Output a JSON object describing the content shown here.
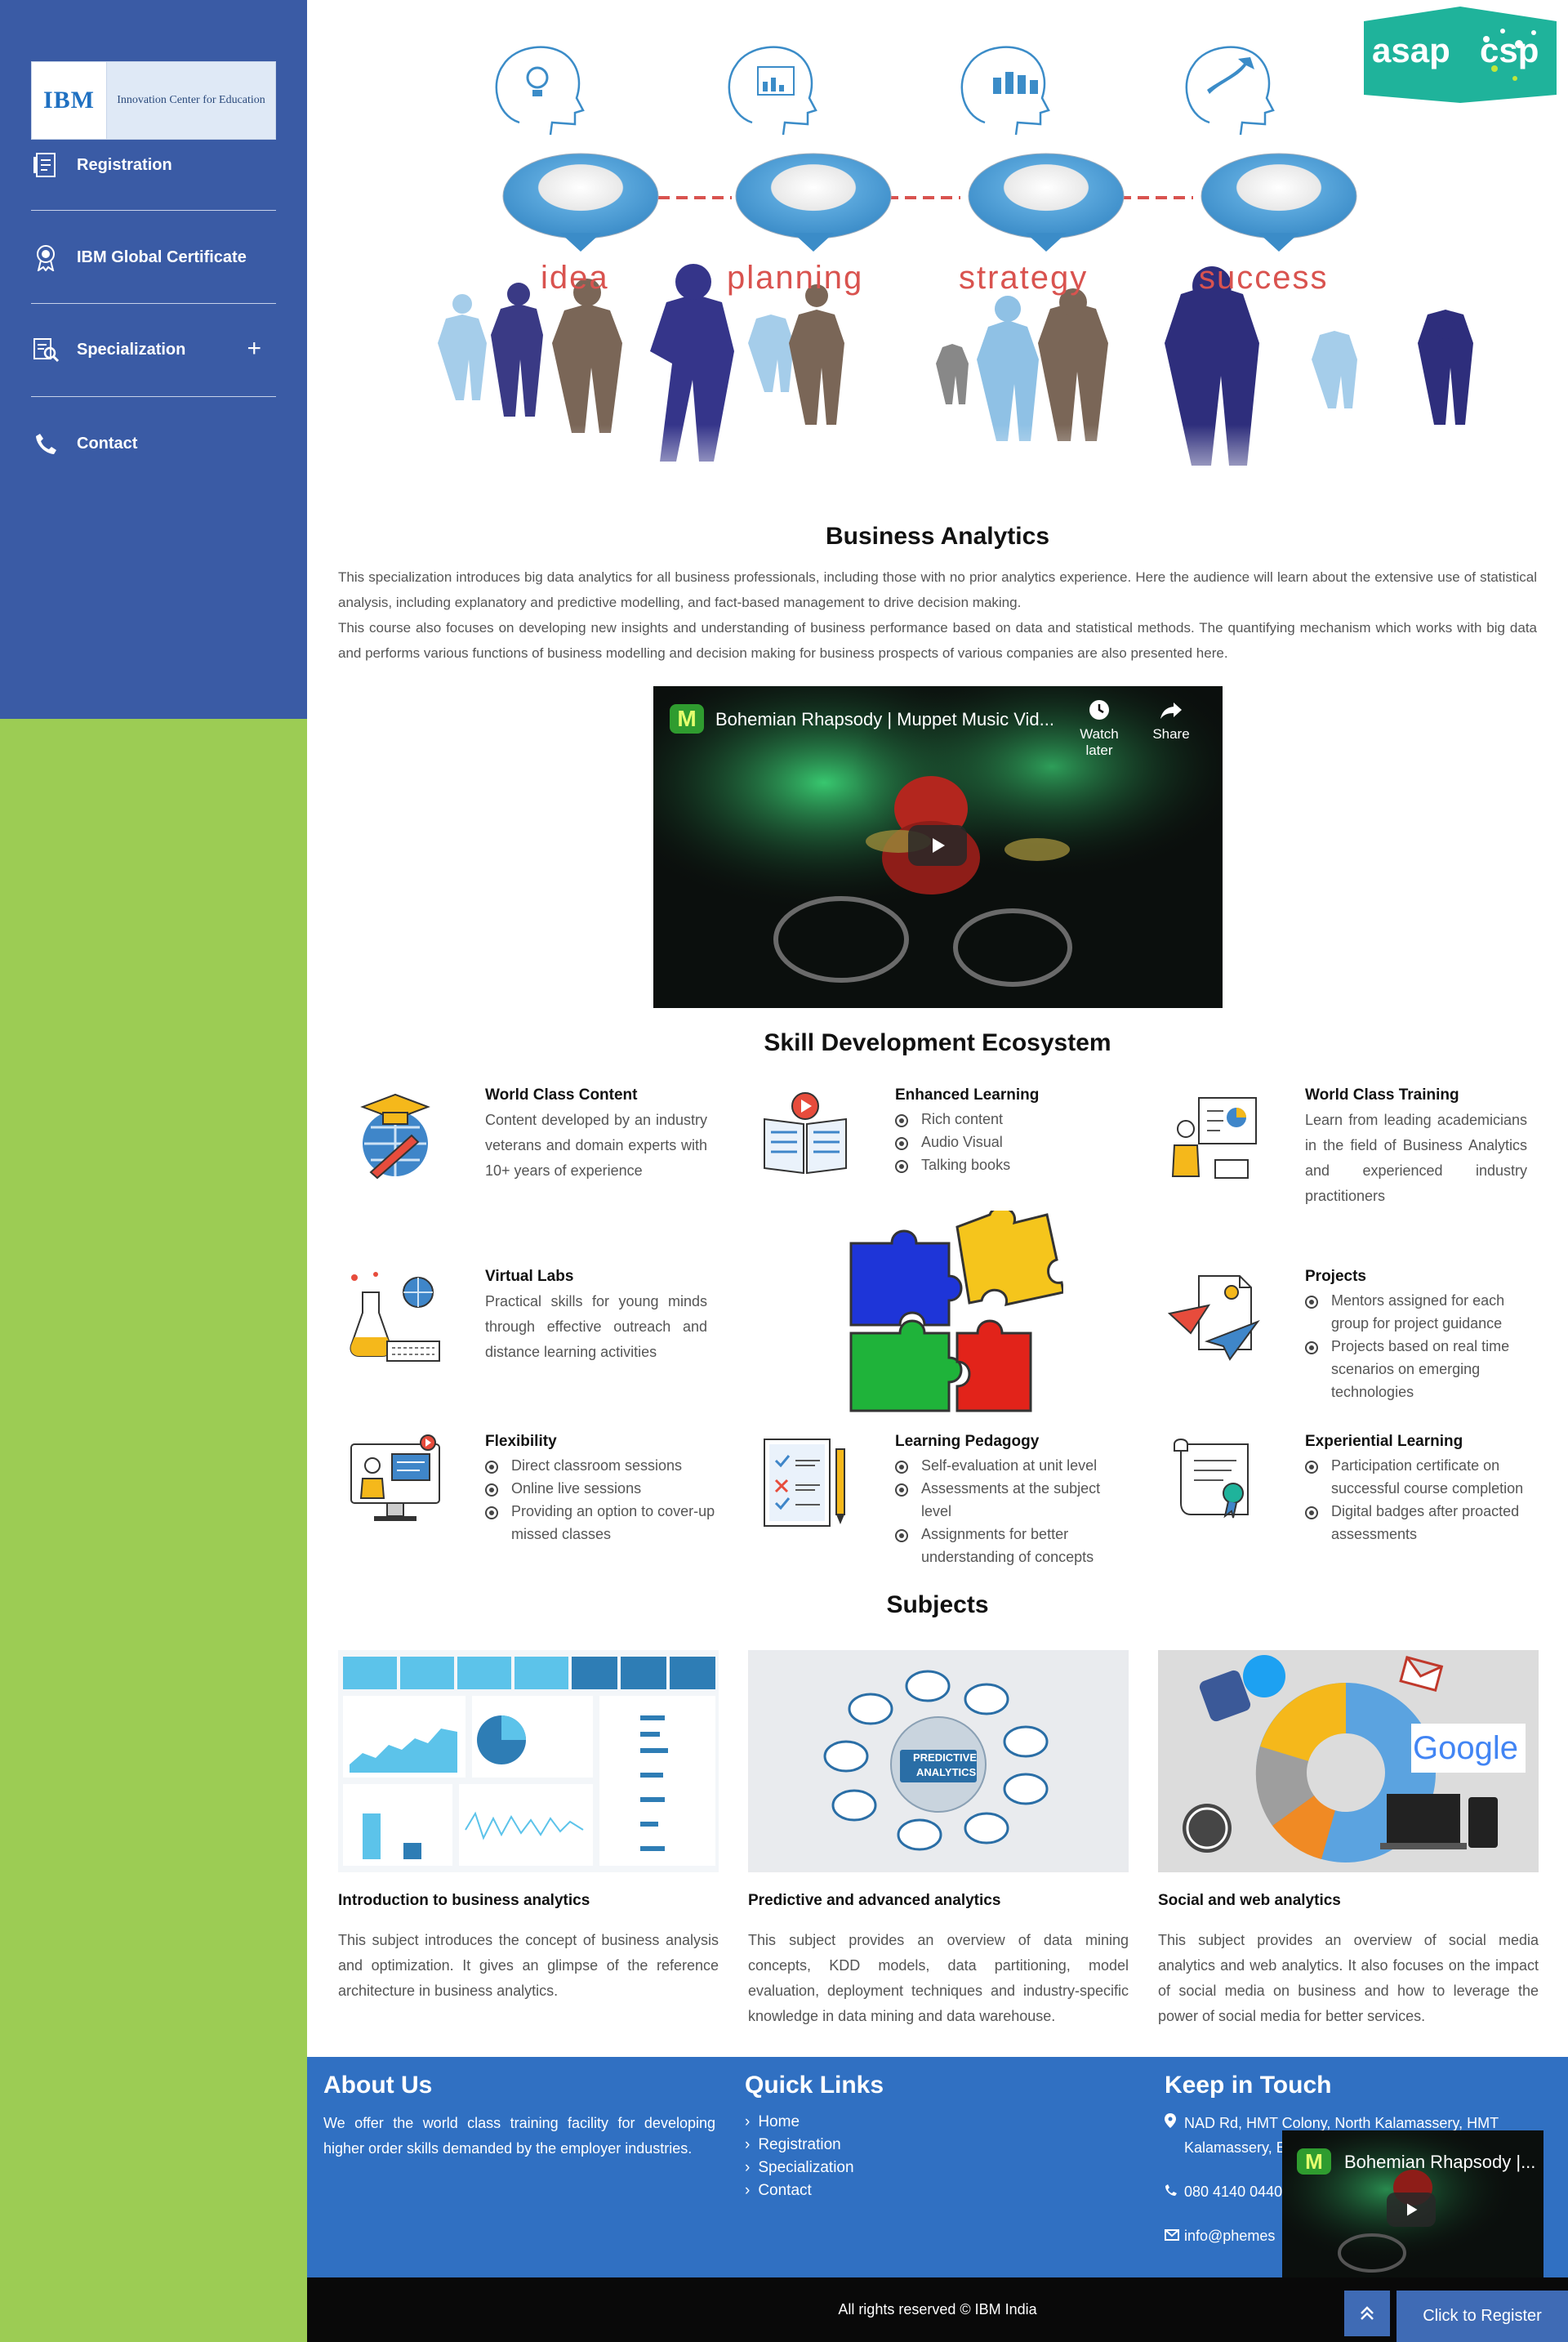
{
  "sidebar": {
    "logo": {
      "brand": "IBM",
      "subtitle": "Innovation Center for Education"
    },
    "items": [
      {
        "label": "Registration",
        "icon": "document-icon"
      },
      {
        "label": "IBM Global Certificate",
        "icon": "award-icon"
      },
      {
        "label": "Specialization",
        "icon": "search-document-icon",
        "expand": "+"
      },
      {
        "label": "Contact",
        "icon": "phone-icon"
      }
    ]
  },
  "hero": {
    "badge": {
      "left": "asap",
      "right": "csp"
    },
    "steps": [
      "idea",
      "planning",
      "strategy",
      "success"
    ]
  },
  "intro": {
    "title": "Business Analytics",
    "p1": "This specialization introduces big data analytics for all business professionals, including those with no prior analytics experience. Here the audience will learn about the extensive use of statistical analysis, including explanatory and predictive modelling, and fact-based management to drive decision making.",
    "p2": "This course also focuses on developing new insights and understanding of business performance based on data and statistical methods. The quantifying mechanism which works with big data and performs various functions of business modelling and decision making for business prospects of various companies are also presented here."
  },
  "video": {
    "title": "Bohemian Rhapsody | Muppet Music Vid...",
    "watch_later": "Watch later",
    "share": "Share",
    "logo_letter": "M"
  },
  "skills": {
    "title": "Skill Development Ecosystem",
    "world_class_content": {
      "title": "World Class Content",
      "body": "Content developed by an industry veterans and domain experts with 10+ years of experience"
    },
    "enhanced_learning": {
      "title": "Enhanced Learning",
      "items": [
        "Rich content",
        "Audio Visual",
        "Talking books"
      ]
    },
    "world_class_training": {
      "title": "World Class Training",
      "body": "Learn from leading academicians in the field of Business Analytics and experienced industry practitioners"
    },
    "virtual_labs": {
      "title": "Virtual Labs",
      "body": "Practical skills for young minds through effective outreach and distance learning activities"
    },
    "projects": {
      "title": "Projects",
      "items": [
        "Mentors assigned for each group for project guidance",
        "Projects based on real time scenarios on emerging technologies"
      ]
    },
    "flexibility": {
      "title": "Flexibility",
      "items": [
        "Direct classroom sessions",
        "Online live sessions",
        "Providing an option to cover-up missed classes"
      ]
    },
    "learning_pedagogy": {
      "title": "Learning Pedagogy",
      "items": [
        "Self-evaluation at unit level",
        "Assessments at the subject level",
        "Assignments for better understanding of concepts"
      ]
    },
    "experiential_learning": {
      "title": "Experiential Learning",
      "items": [
        "Participation certificate on successful course completion",
        "Digital badges after proacted assessments"
      ]
    }
  },
  "subjects": {
    "title": "Subjects",
    "intro": {
      "title": "Introduction to business analytics",
      "body": "This subject introduces the concept of business analysis and optimization. It gives an glimpse of the reference architecture in business analytics."
    },
    "predictive": {
      "title": "Predictive and advanced analytics",
      "body": "This subject provides an overview of data mining concepts, KDD models, data partitioning, model evaluation, deployment techniques and industry-specific knowledge in data mining and data warehouse.",
      "img_label_1": "PREDICTIVE",
      "img_label_2": "ANALYTICS"
    },
    "social": {
      "title": "Social and web analytics",
      "body": "This subject provides an overview of social media analytics and web analytics. It also focuses on the impact of social media on business and how to leverage the power of social media for better services.",
      "img_label": "Google"
    }
  },
  "footer": {
    "about": {
      "title": "About Us",
      "body": "We offer the world class training facility for developing higher order skills demanded by the employer industries."
    },
    "links": {
      "title": "Quick Links",
      "items": [
        "Home",
        "Registration",
        "Specialization",
        "Contact"
      ]
    },
    "contact": {
      "title": "Keep in Touch",
      "address": "NAD Rd, HMT Colony, North Kalamassery, HMT Kalamassery, Ern",
      "phone": "080 4140 0440",
      "email": "info@phemes"
    },
    "copyright": "All rights reserved © IBM India"
  },
  "mini_video": {
    "title": "Bohemian Rhapsody |...",
    "logo_letter": "M"
  },
  "register_button": "Click to Register"
}
